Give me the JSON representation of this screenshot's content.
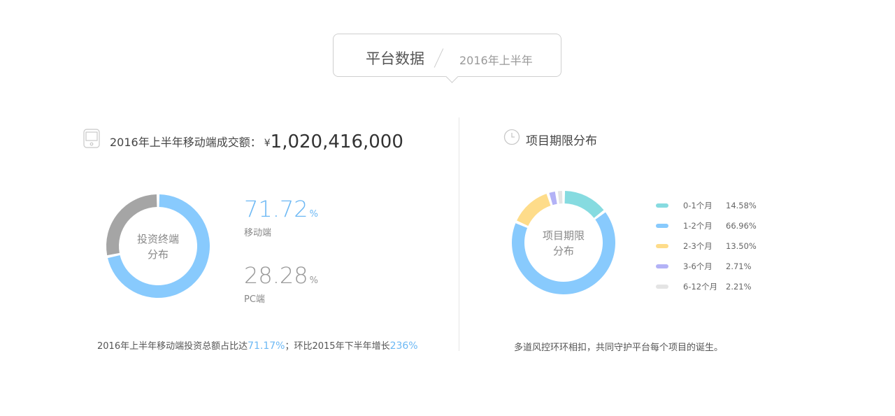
{
  "header": {
    "title": "平台数据",
    "period": "2016年上半年"
  },
  "left_panel": {
    "heading": "2016年上半年移动端成交额：",
    "currency": "¥",
    "amount": "1,020,416,000",
    "donut_label_line1": "投资终端",
    "donut_label_line2": "分布",
    "stats": [
      {
        "value": "71.72",
        "unit": "%",
        "label": "移动端",
        "color": "#6cb8f4"
      },
      {
        "value": "28.28",
        "unit": "%",
        "label": "PC端",
        "color": "#999999"
      }
    ],
    "footnote_part1": "2016年上半年移动端投资总额占比达",
    "footnote_hl1": "71.17%",
    "footnote_part2": "；环比2015年下半年增长",
    "footnote_hl2": "236%"
  },
  "right_panel": {
    "heading": "项目期限分布",
    "donut_label_line1": "项目期限",
    "donut_label_line2": "分布",
    "footnote": "多道风控环环相扣，共同守护平台每个项目的诞生。"
  },
  "icons": {
    "left_heading_icon": "tablet-icon",
    "right_heading_icon": "clock-icon"
  },
  "chart_data": [
    {
      "type": "pie",
      "categories": [
        "移动端",
        "PC端"
      ],
      "values": [
        71.72,
        28.28
      ],
      "colors": [
        "#88cafd",
        "#a5a5a5"
      ]
    },
    {
      "type": "pie",
      "categories": [
        "0-1个月",
        "1-2个月",
        "2-3个月",
        "3-6个月",
        "6-12个月"
      ],
      "values": [
        14.58,
        66.96,
        13.5,
        2.71,
        2.21
      ],
      "display_values": [
        "14.58%",
        "66.96%",
        "13.50%",
        "2.71%",
        "2.21%"
      ],
      "colors": [
        "#86dbe0",
        "#88cafd",
        "#fedc8a",
        "#b3b2f6",
        "#e4e4e4"
      ],
      "legend_position": "right"
    }
  ]
}
